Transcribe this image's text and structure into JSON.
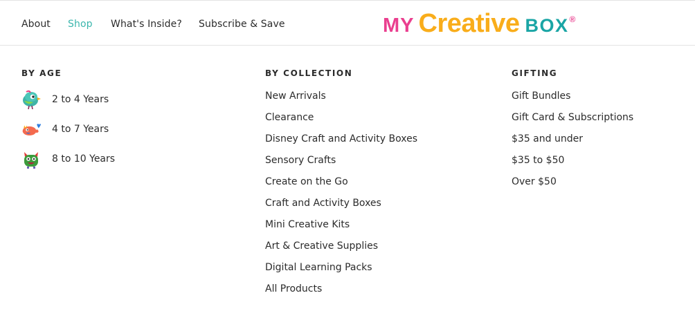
{
  "theme": {
    "accent": "#3bb6ad",
    "text": "#2b2b2b",
    "logo_pink": "#ea3f8f",
    "logo_orange": "#f9ad1b",
    "logo_teal": "#1aa5a5"
  },
  "nav": {
    "items": [
      {
        "label": "About",
        "active": false
      },
      {
        "label": "Shop",
        "active": true
      },
      {
        "label": "What's Inside?",
        "active": false
      },
      {
        "label": "Subscribe & Save",
        "active": false
      }
    ]
  },
  "logo": {
    "part1": "MY",
    "part2": "Creative",
    "part3": "BOX",
    "mark": "®"
  },
  "menu": {
    "by_age": {
      "heading": "BY AGE",
      "items": [
        {
          "label": "2 to 4 Years",
          "icon": "bird-mascot-icon"
        },
        {
          "label": "4 to 7 Years",
          "icon": "whale-mascot-icon"
        },
        {
          "label": "8 to 10 Years",
          "icon": "monster-mascot-icon"
        }
      ]
    },
    "by_collection": {
      "heading": "BY COLLECTION",
      "items": [
        "New Arrivals",
        "Clearance",
        "Disney Craft and Activity Boxes",
        "Sensory Crafts",
        "Create on the Go",
        "Craft and Activity Boxes",
        "Mini Creative Kits",
        "Art & Creative Supplies",
        "Digital Learning Packs",
        "All Products"
      ]
    },
    "gifting": {
      "heading": "GIFTING",
      "items": [
        "Gift Bundles",
        "Gift Card & Subscriptions",
        "$35 and under",
        "$35 to $50",
        "Over $50"
      ]
    }
  }
}
